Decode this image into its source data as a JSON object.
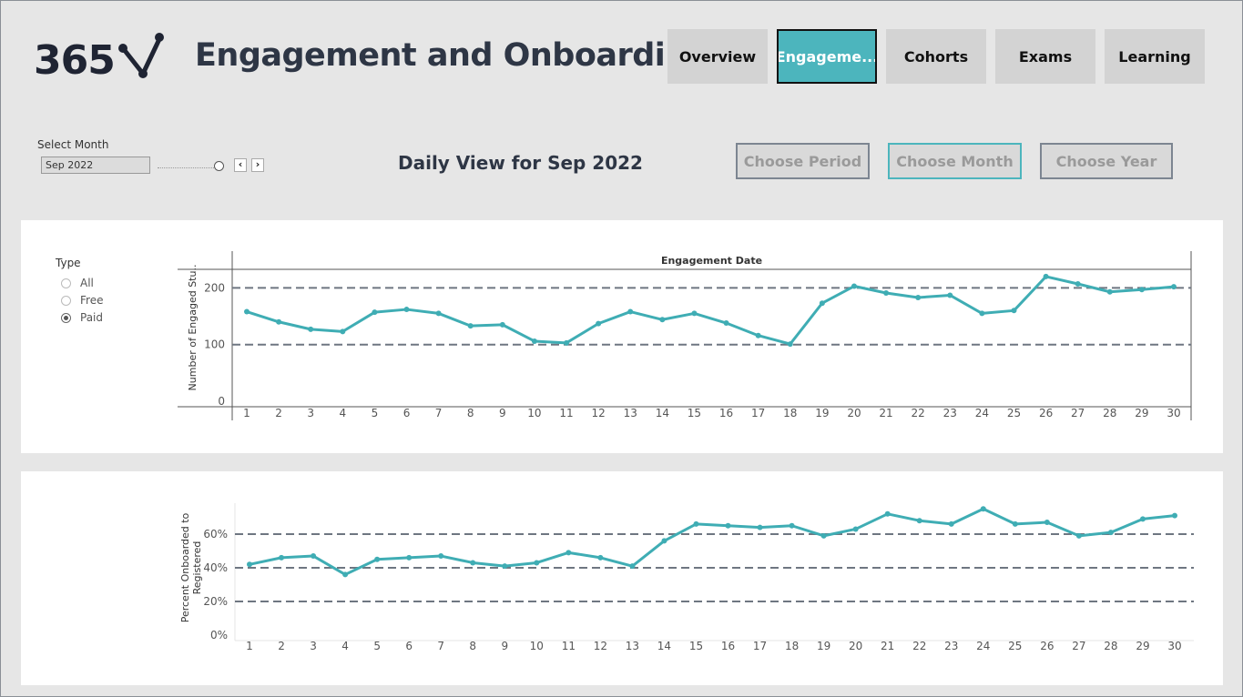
{
  "header": {
    "logo_text": "365",
    "title": "Engagement and Onboarding"
  },
  "nav": {
    "tabs": [
      {
        "label": "Overview",
        "active": false
      },
      {
        "label": "Engageme...",
        "active": true
      },
      {
        "label": "Cohorts",
        "active": false
      },
      {
        "label": "Exams",
        "active": false
      },
      {
        "label": "Learning",
        "active": false
      }
    ]
  },
  "controls": {
    "select_month_label": "Select Month",
    "select_month_value": "Sep 2022",
    "prev_icon": "chevron-left-icon",
    "next_icon": "chevron-right-icon",
    "prev_glyph": "‹",
    "next_glyph": "›",
    "view_title": "Daily View for Sep 2022",
    "choose_period": "Choose Period",
    "choose_month": "Choose Month",
    "choose_year": "Choose Year"
  },
  "filter": {
    "title": "Type",
    "options": [
      {
        "label": "All",
        "selected": false
      },
      {
        "label": "Free",
        "selected": false
      },
      {
        "label": "Paid",
        "selected": true
      }
    ]
  },
  "colors": {
    "accent": "#4cb5bd",
    "line": "#3fadb4",
    "reference": "#6e7681",
    "title": "#2e3645"
  },
  "chart_data": [
    {
      "type": "line",
      "title": "Engagement Date",
      "xlabel": "",
      "ylabel": "Number of Engaged Stu..",
      "x": [
        1,
        2,
        3,
        4,
        5,
        6,
        7,
        8,
        9,
        10,
        11,
        12,
        13,
        14,
        15,
        16,
        17,
        18,
        19,
        20,
        21,
        22,
        23,
        24,
        25,
        26,
        27,
        28,
        29,
        30
      ],
      "values": [
        158,
        140,
        127,
        123,
        157,
        162,
        155,
        133,
        135,
        106,
        103,
        137,
        158,
        144,
        155,
        138,
        116,
        101,
        173,
        203,
        191,
        183,
        187,
        155,
        160,
        220,
        207,
        193,
        197,
        202
      ],
      "yticks": [
        0,
        100,
        200
      ],
      "ylim": [
        0,
        240
      ],
      "reference_lines": [
        100,
        200
      ],
      "grid": false
    },
    {
      "type": "line",
      "xlabel": "",
      "ylabel": "Percent Onboarded to Registered",
      "x": [
        1,
        2,
        3,
        4,
        5,
        6,
        7,
        8,
        9,
        10,
        11,
        12,
        13,
        14,
        15,
        16,
        17,
        18,
        19,
        20,
        21,
        22,
        23,
        24,
        25,
        26,
        27,
        28,
        29,
        30
      ],
      "values": [
        42,
        46,
        47,
        36,
        45,
        46,
        47,
        43,
        41,
        43,
        49,
        46,
        41,
        56,
        66,
        65,
        64,
        65,
        59,
        63,
        72,
        68,
        66,
        75,
        66,
        67,
        59,
        61,
        69,
        71
      ],
      "yticks": [
        "0%",
        "20%",
        "40%",
        "60%"
      ],
      "ylim": [
        0,
        80
      ],
      "reference_lines": [
        20,
        40,
        60
      ],
      "grid": false
    }
  ]
}
